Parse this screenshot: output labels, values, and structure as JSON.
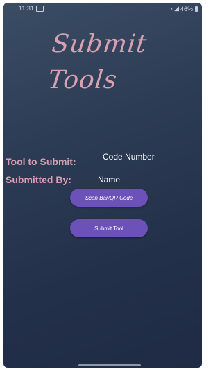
{
  "status_bar": {
    "time": "11:31",
    "battery": "46%",
    "icons": [
      "image-icon",
      "wifi-icon",
      "signal-icon",
      "battery-icon"
    ]
  },
  "header": {
    "title": "Submit\nTools"
  },
  "form": {
    "tool_label": "Tool to Submit:",
    "tool_field_value": "Code Number",
    "submitted_by_label": "Submitted By:",
    "submitted_by_value": "Name"
  },
  "actions": {
    "scan_label": "Scan Bar/QR Code",
    "submit_label": "Submit Tool"
  },
  "colors": {
    "accent_pink": "#d7a1b2",
    "button_purple": "#6c52b8",
    "background_top": "#3a4d64",
    "background_bottom": "#1f2b44"
  }
}
